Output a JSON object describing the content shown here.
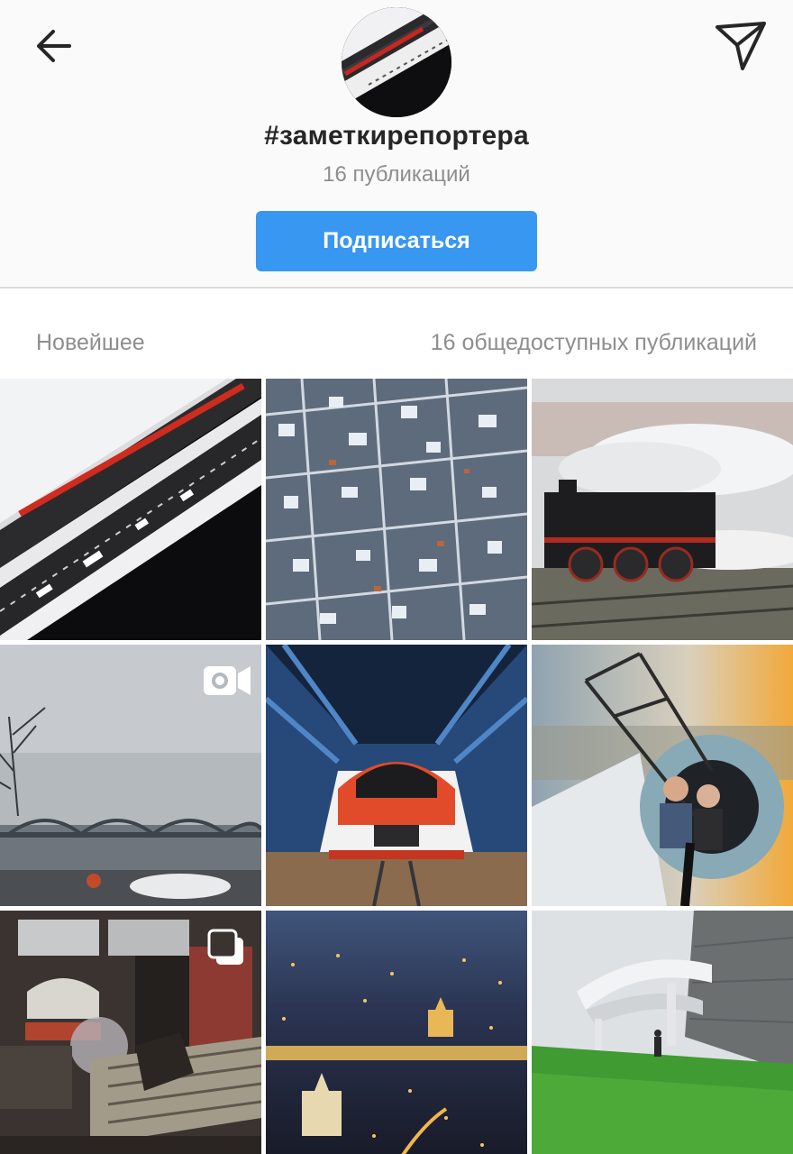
{
  "header": {
    "back_icon": "arrow-left-icon",
    "share_icon": "paper-plane-icon",
    "hashtag": "#заметкирепортера",
    "post_count": "16 публикаций",
    "follow_label": "Подписаться"
  },
  "section": {
    "sort_label": "Новейшее",
    "public_count": "16 общедоступных публикаций"
  },
  "grid": {
    "tiles": [
      {
        "scene": "aerial-highway-train-snow"
      },
      {
        "scene": "aerial-snowy-village"
      },
      {
        "scene": "steam-locomotive"
      },
      {
        "scene": "river-bridge-overcast",
        "badge": "video-camera-icon"
      },
      {
        "scene": "high-speed-train-depot"
      },
      {
        "scene": "rooftop-selfie-spire"
      },
      {
        "scene": "workshop-interior",
        "badge": "multiple-photos-icon"
      },
      {
        "scene": "city-night-panorama"
      },
      {
        "scene": "highway-interchange-grass"
      }
    ]
  },
  "colors": {
    "accent": "#3897f0",
    "text_primary": "#262626",
    "text_secondary": "#8e8e8e",
    "header_bg": "#fafafa",
    "divider": "#dbdbdb"
  }
}
